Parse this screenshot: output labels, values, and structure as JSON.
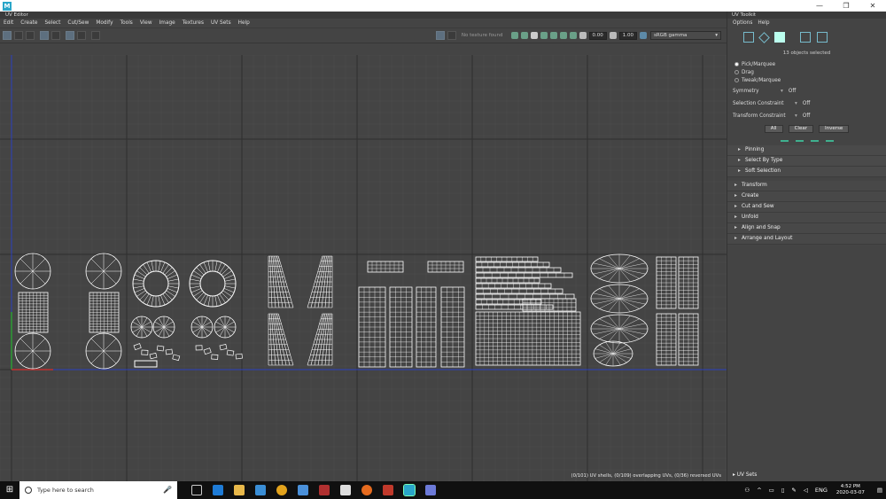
{
  "window": {
    "app_icon": "M",
    "controls": [
      "—",
      "❐",
      "✕"
    ]
  },
  "uv_editor": {
    "title": "UV Editor",
    "menu": [
      "Edit",
      "Create",
      "Select",
      "Cut/Sew",
      "Modify",
      "Tools",
      "View",
      "Image",
      "Textures",
      "UV Sets",
      "Help"
    ],
    "no_texture": "No texture found",
    "value_a": "0.00",
    "value_b": "1.00",
    "color_space": "sRGB gamma",
    "status": "(0/101) UV shells, (0/109) overlapping UVs, (0/36) reversed UVs"
  },
  "toolkit": {
    "title": "UV Toolkit",
    "menu": [
      "Options",
      "Help"
    ],
    "selected": "13 objects selected",
    "modes": [
      "Pick/Marquee",
      "Drag",
      "Tweak/Marquee"
    ],
    "symmetry": {
      "label": "Symmetry",
      "value": "Off"
    },
    "selection_constraint": {
      "label": "Selection Constraint",
      "value": "Off"
    },
    "transform_constraint": {
      "label": "Transform Constraint",
      "value": "Off"
    },
    "buttons": [
      "All",
      "Clear",
      "Inverse"
    ],
    "subsections": [
      "Pinning",
      "Select By Type",
      "Soft Selection"
    ],
    "sections": [
      "Transform",
      "Create",
      "Cut and Sew",
      "Unfold",
      "Align and Snap",
      "Arrange and Layout"
    ],
    "uv_sets": "UV Sets"
  },
  "taskbar": {
    "search_placeholder": "Type here to search",
    "lang": "ENG",
    "time": "4:52 PM",
    "date": "2020-03-07"
  },
  "theme": {
    "accent": "#3fb08f",
    "grid_bg": "#444444",
    "uv_line": "#ffffff",
    "u_axis": "#2a3fc0",
    "v_axis": "#2b9c35"
  }
}
